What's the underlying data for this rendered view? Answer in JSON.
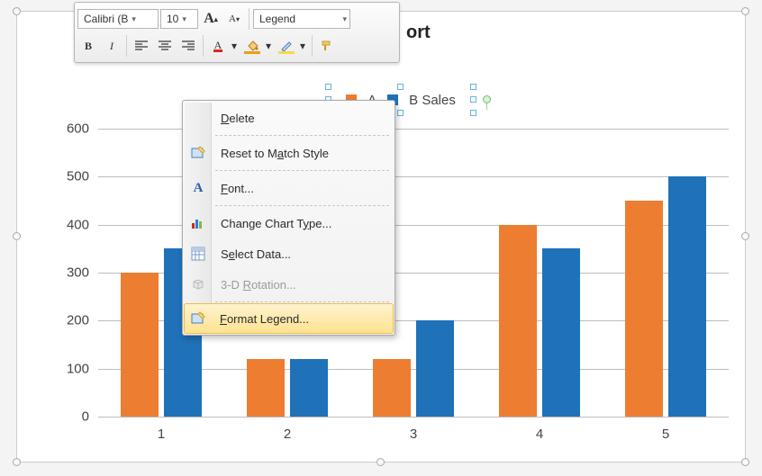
{
  "chart_data": {
    "type": "bar",
    "title_visible_fragment": "ort",
    "categories": [
      "1",
      "2",
      "3",
      "4",
      "5"
    ],
    "series": [
      {
        "name": "A",
        "color": "#ed7d31",
        "values": [
          300,
          120,
          120,
          400,
          450
        ]
      },
      {
        "name": "B Sales",
        "color": "#1f71b8",
        "values": [
          350,
          120,
          200,
          350,
          500
        ]
      }
    ],
    "y_ticks": [
      0,
      100,
      200,
      300,
      400,
      500,
      600
    ],
    "ylim": [
      0,
      600
    ],
    "xlabel": "",
    "ylabel": ""
  },
  "mini_toolbar": {
    "font_name": "Calibri (B",
    "font_size": "10",
    "element_combo": "Legend",
    "grow_font_label": "A",
    "shrink_font_label": "A",
    "bold_label": "B",
    "italic_label": "I",
    "color_letter": "A"
  },
  "context_menu": {
    "items": [
      {
        "id": "delete",
        "label_pre": "",
        "mn": "D",
        "label_post": "elete",
        "enabled": true,
        "sep_after": true
      },
      {
        "id": "reset-to-match",
        "label_pre": "Reset to M",
        "mn": "a",
        "label_post": "tch Style",
        "enabled": true,
        "sep_after": true
      },
      {
        "id": "font",
        "label_pre": "",
        "mn": "F",
        "label_post": "ont...",
        "enabled": true,
        "sep_after": true
      },
      {
        "id": "change-chart-type",
        "label_pre": "Change Chart T",
        "mn": "y",
        "label_post": "pe...",
        "enabled": true,
        "sep_after": false
      },
      {
        "id": "select-data",
        "label_pre": "S",
        "mn": "e",
        "label_post": "lect Data...",
        "enabled": true,
        "sep_after": false
      },
      {
        "id": "3d-rotation",
        "label_pre": "3-D ",
        "mn": "R",
        "label_post": "otation...",
        "enabled": false,
        "sep_after": true
      },
      {
        "id": "format-legend",
        "label_pre": "",
        "mn": "F",
        "label_post": "ormat Legend...",
        "enabled": true,
        "sep_after": false,
        "hover": true
      }
    ]
  }
}
